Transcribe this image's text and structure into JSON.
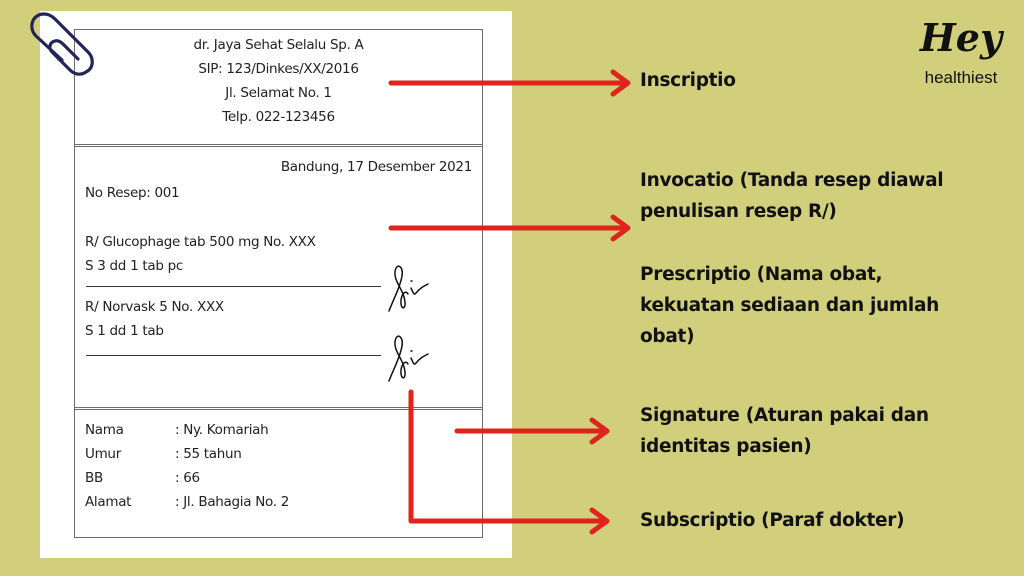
{
  "brand": {
    "title": "Hey",
    "subtitle": "healthiest"
  },
  "prescription": {
    "header": {
      "doctor": "dr. Jaya Sehat Selalu Sp. A",
      "sip": "SIP: 123/Dinkes/XX/2016",
      "address": "Jl. Selamat No. 1",
      "phone": "Telp. 022-123456"
    },
    "body": {
      "place_date": "Bandung, 17 Desember 2021",
      "number": "No Resep: 001",
      "items": [
        {
          "drug": "R/ Glucophage tab 500 mg No. XXX",
          "usage": "S 3 dd 1 tab pc",
          "paraf": "signature"
        },
        {
          "drug": "R/ Norvask 5 No. XXX",
          "usage": "S 1 dd 1 tab",
          "paraf": "signature"
        }
      ]
    },
    "patient": [
      {
        "key": "Nama",
        "value": ": Ny. Komariah"
      },
      {
        "key": "Umur",
        "value": ": 55 tahun"
      },
      {
        "key": "BB",
        "value": ": 66"
      },
      {
        "key": "Alamat",
        "value": ": Jl. Bahagia No. 2"
      }
    ]
  },
  "labels": {
    "inscriptio": "Inscriptio",
    "invocatio": [
      "Invocatio (Tanda resep diawal",
      "penulisan resep R/)"
    ],
    "prescriptio": [
      "Prescriptio (Nama obat,",
      "kekuatan sediaan dan jumlah",
      "obat)"
    ],
    "signature": [
      "Signature (Aturan pakai dan",
      "identitas pasien)"
    ],
    "subscriptio": "Subscriptio (Paraf dokter)"
  },
  "colors": {
    "background": "#d1cf7b",
    "arrow": "#e0231c",
    "paperclip": "#24245a",
    "paper": "#ffffff"
  }
}
